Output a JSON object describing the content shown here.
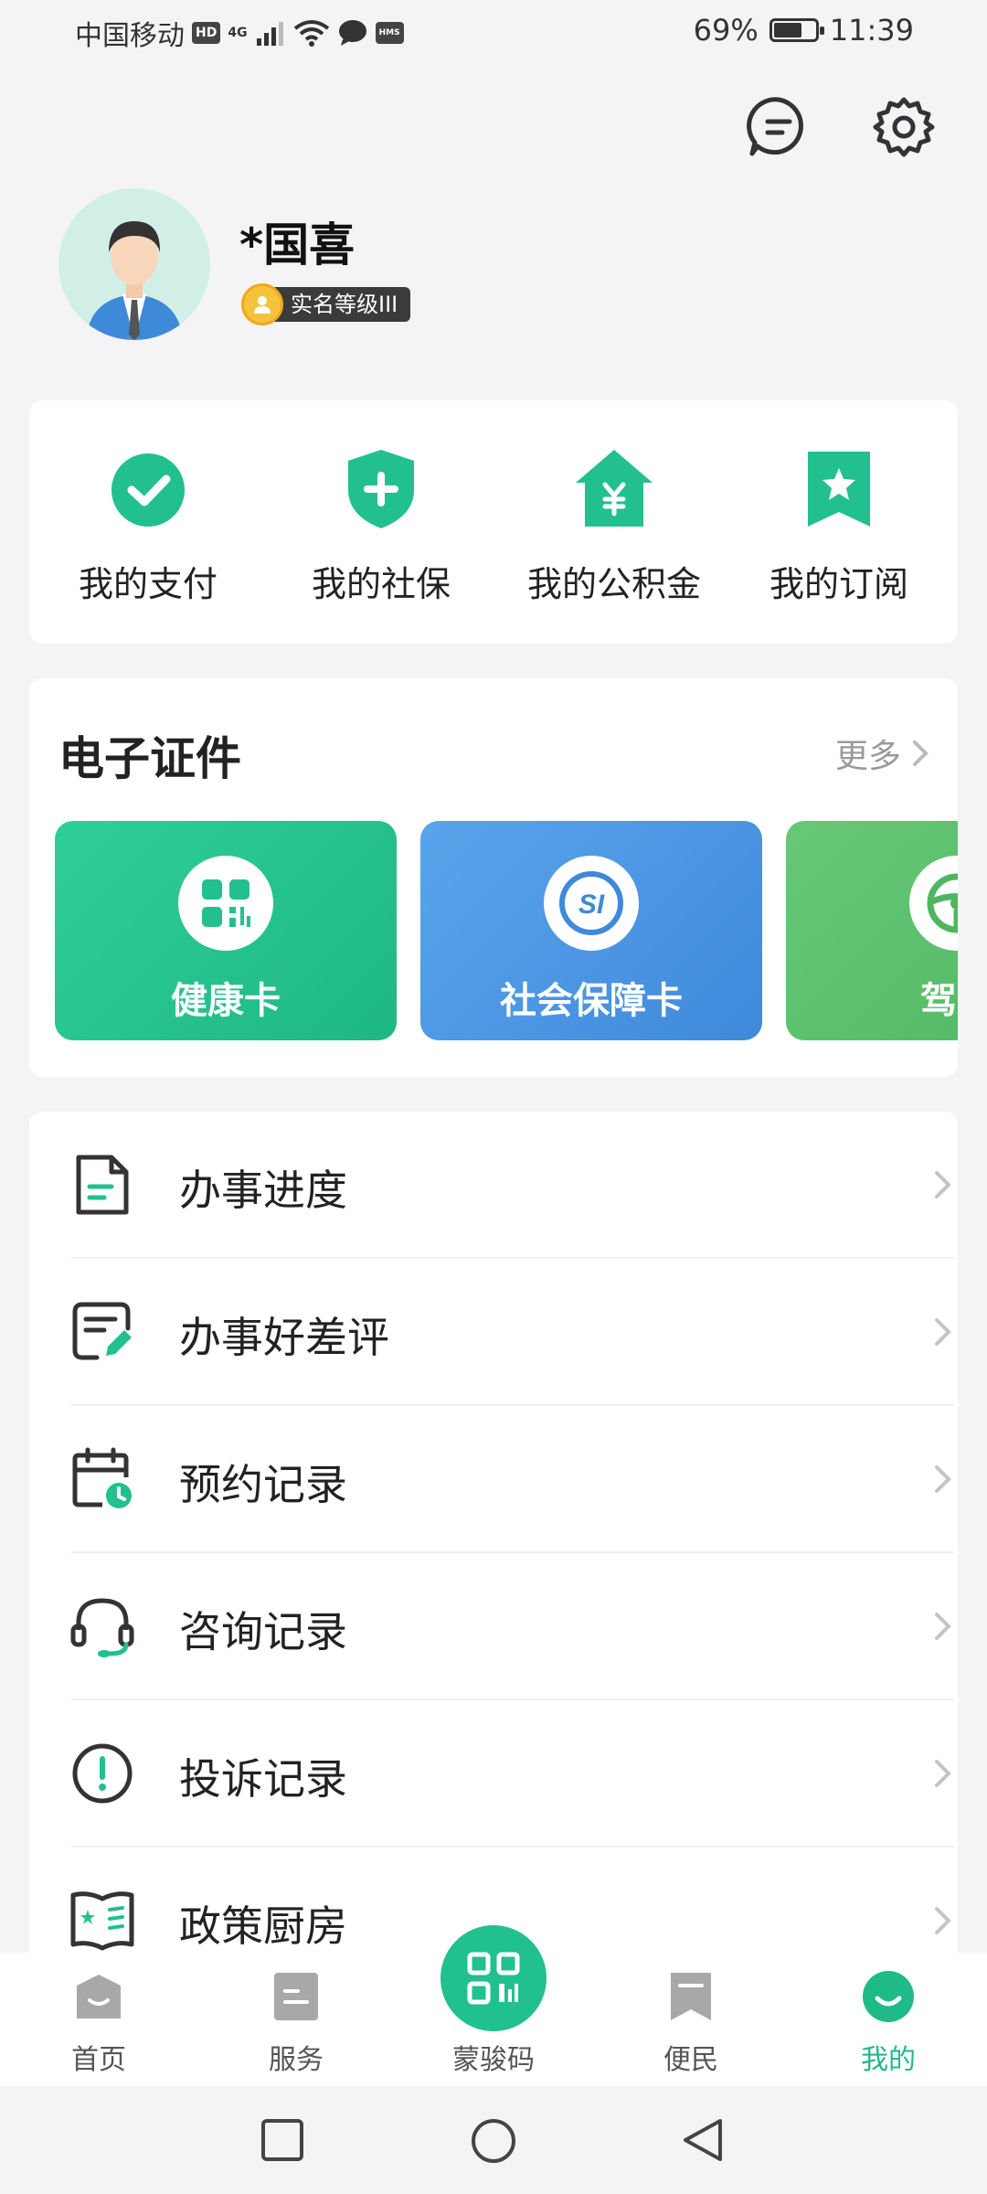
{
  "status_bar": {
    "carrier": "中国移动",
    "hd_badge": "HD",
    "network": "4G",
    "hms_badge": "HMS",
    "battery": "69%",
    "battery_level": 0.69,
    "time": "11:39"
  },
  "header": {
    "icons": [
      "message-icon",
      "settings-icon"
    ]
  },
  "profile": {
    "name": "*国喜",
    "level": "实名等级III"
  },
  "quick_actions": [
    {
      "label": "我的支付",
      "icon": "check-icon"
    },
    {
      "label": "我的社保",
      "icon": "shield-plus-icon"
    },
    {
      "label": "我的公积金",
      "icon": "house-yuan-icon"
    },
    {
      "label": "我的订阅",
      "icon": "bookmark-star-icon"
    }
  ],
  "certificates": {
    "title": "电子证件",
    "more": "更多",
    "cards": [
      {
        "label": "健康卡",
        "color": "#22c08e",
        "icon": "qr-code-icon"
      },
      {
        "label": "社会保障卡",
        "color": "#4d97e4",
        "icon": "si-logo-icon"
      },
      {
        "label": "驾驶",
        "color": "#5cbf6c",
        "icon": "steering-wheel-icon"
      }
    ]
  },
  "menu": [
    {
      "label": "办事进度",
      "icon": "document-icon"
    },
    {
      "label": "办事好差评",
      "icon": "review-edit-icon"
    },
    {
      "label": "预约记录",
      "icon": "calendar-clock-icon"
    },
    {
      "label": "咨询记录",
      "icon": "headset-icon"
    },
    {
      "label": "投诉记录",
      "icon": "alert-circle-icon"
    },
    {
      "label": "政策厨房",
      "icon": "policy-book-icon"
    }
  ],
  "bottom_nav": [
    {
      "label": "首页",
      "icon": "home-icon"
    },
    {
      "label": "服务",
      "icon": "service-icon"
    },
    {
      "label": "蒙骏码",
      "icon": "scan-code-icon"
    },
    {
      "label": "便民",
      "icon": "bookmark-icon"
    },
    {
      "label": "我的",
      "icon": "profile-icon",
      "active": true
    }
  ],
  "colors": {
    "accent": "#21c08f",
    "inactive_nav": "#555555"
  }
}
